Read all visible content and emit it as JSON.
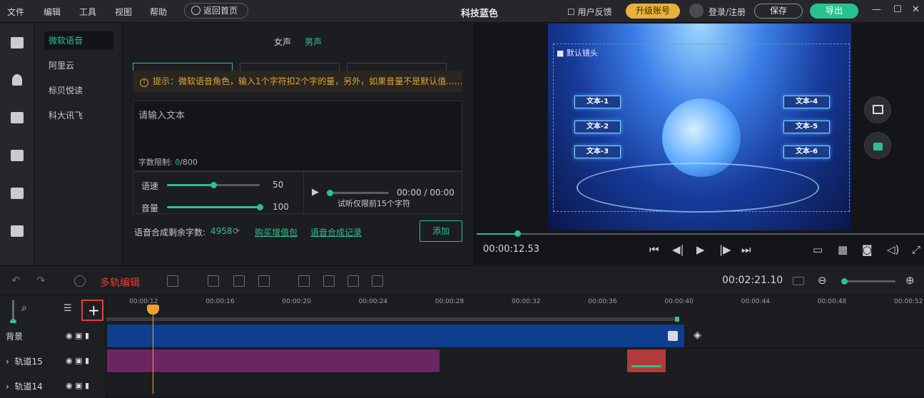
{
  "menu": [
    "文件",
    "编辑",
    "工具",
    "视图",
    "帮助"
  ],
  "home_button": "返回首页",
  "app_title": "科技蓝色",
  "feedback": "用户反馈",
  "upgrade": "升级账号",
  "login": "登录/注册",
  "save": "保存",
  "export": "导出",
  "engines": [
    "微软语音",
    "阿里云",
    "标贝悦读",
    "科大讯飞"
  ],
  "voice_tabs": {
    "female": "女声",
    "male": "男声"
  },
  "tip": "提示：微软语音角色，输入1个字符扣2个字的量，另外，如果音量不是默认值......",
  "text_placeholder": "请输入文本",
  "char_limit_label": "字数限制: ",
  "char_limit_used": "0",
  "char_limit_max": "/800",
  "speed_label": "语速",
  "speed_value": "50",
  "volume_label": "音量",
  "volume_value": "100",
  "speed_level": 0.5,
  "volume_level": 1.0,
  "audition_time": "00:00 / 00:00",
  "audition_note": "试听仅限前15个字符",
  "remaining_label": "语音合成剩余字数:",
  "remaining_value": "4958",
  "buy_link": "购买增值包",
  "history_link": "语音合成记录",
  "add_button": "添加",
  "preview": {
    "camera_label": "默认镜头",
    "boxes": [
      "文本-1",
      "文本-2",
      "文本-3",
      "文本-4",
      "文本-5",
      "文本-6"
    ],
    "current_time": "00:00:12.53"
  },
  "timeline": {
    "total_time": "00:02:21.10",
    "annotation": "多轨编辑",
    "ticks": [
      "00:00:12",
      "00:00:16",
      "00:00:20",
      "00:00:24",
      "00:00:28",
      "00:00:32",
      "00:00:36",
      "00:00:40",
      "00:00:44",
      "00:00:48",
      "00:00:52"
    ],
    "tracks": [
      "背景",
      "轨道15",
      "轨道14"
    ]
  },
  "colors": {
    "accent": "#29c28e",
    "upgrade": "#e8b13a",
    "bg_clip": "#0e3f8f",
    "track15_clip": "#6a2663",
    "tip_text": "#e0a53a"
  }
}
